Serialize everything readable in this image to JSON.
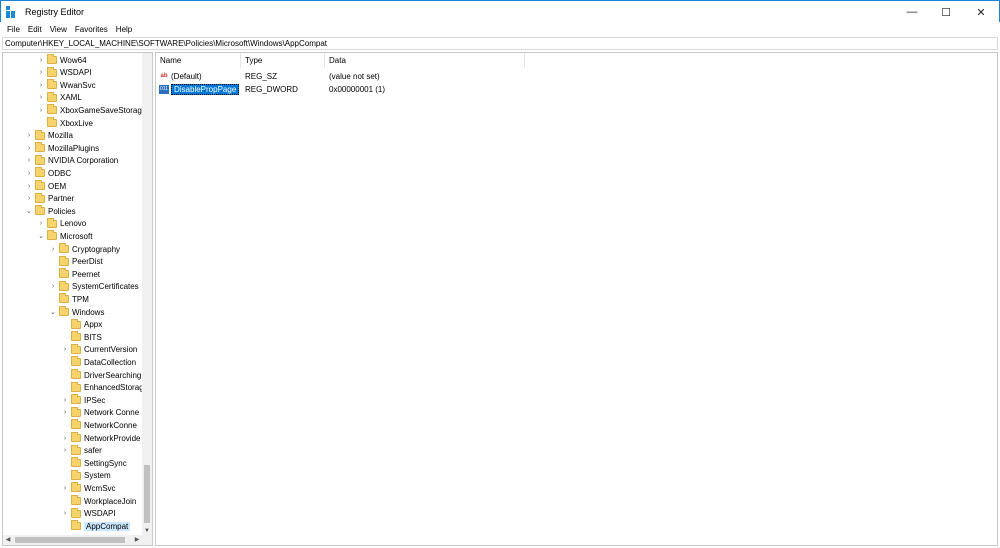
{
  "window": {
    "title": "Registry Editor",
    "minimize_glyph": "—",
    "maximize_glyph": "☐",
    "close_glyph": "✕"
  },
  "menu": [
    "File",
    "Edit",
    "View",
    "Favorites",
    "Help"
  ],
  "address": "Computer\\HKEY_LOCAL_MACHINE\\SOFTWARE\\Policies\\Microsoft\\Windows\\AppCompat",
  "tree": [
    {
      "label": "Wow64",
      "chevron": "›"
    },
    {
      "label": "WSDAPI",
      "chevron": "›"
    },
    {
      "label": "WwanSvc",
      "chevron": "›"
    },
    {
      "label": "XAML",
      "chevron": "›"
    },
    {
      "label": "XboxGameSaveStorag",
      "chevron": "›"
    },
    {
      "label": "XboxLive",
      "chevron": ""
    },
    {
      "label": "Mozilla",
      "chevron": "›"
    },
    {
      "label": "MozillaPlugins",
      "chevron": "›"
    },
    {
      "label": "NVIDIA Corporation",
      "chevron": "›"
    },
    {
      "label": "ODBC",
      "chevron": "›"
    },
    {
      "label": "OEM",
      "chevron": "›"
    },
    {
      "label": "Partner",
      "chevron": "›"
    },
    {
      "label": "Policies",
      "chevron": "⌄"
    },
    {
      "label": "Lenovo",
      "chevron": "›"
    },
    {
      "label": "Microsoft",
      "chevron": "⌄"
    },
    {
      "label": "Cryptography",
      "chevron": "›"
    },
    {
      "label": "PeerDist",
      "chevron": ""
    },
    {
      "label": "Peernet",
      "chevron": ""
    },
    {
      "label": "SystemCertificates",
      "chevron": "›"
    },
    {
      "label": "TPM",
      "chevron": ""
    },
    {
      "label": "Windows",
      "chevron": "⌄"
    },
    {
      "label": "Appx",
      "chevron": ""
    },
    {
      "label": "BITS",
      "chevron": ""
    },
    {
      "label": "CurrentVersion",
      "chevron": "›"
    },
    {
      "label": "DataCollection",
      "chevron": ""
    },
    {
      "label": "DriverSearching",
      "chevron": ""
    },
    {
      "label": "EnhancedStorag",
      "chevron": ""
    },
    {
      "label": "IPSec",
      "chevron": "›"
    },
    {
      "label": "Network Conne",
      "chevron": "›"
    },
    {
      "label": "NetworkConne",
      "chevron": ""
    },
    {
      "label": "NetworkProvide",
      "chevron": "›"
    },
    {
      "label": "safer",
      "chevron": "›"
    },
    {
      "label": "SettingSync",
      "chevron": ""
    },
    {
      "label": "System",
      "chevron": ""
    },
    {
      "label": "WcmSvc",
      "chevron": "›"
    },
    {
      "label": "WorkplaceJoin",
      "chevron": ""
    },
    {
      "label": "WSDAPI",
      "chevron": "›"
    },
    {
      "label": "AppCompat",
      "chevron": "",
      "selected": true
    }
  ],
  "columns": {
    "name": "Name",
    "type": "Type",
    "data": "Data"
  },
  "values": [
    {
      "icon": "ab",
      "name": "(Default)",
      "type": "REG_SZ",
      "data": "(value not set)"
    },
    {
      "icon": "011",
      "name": "DisablePropPage",
      "type": "REG_DWORD",
      "data": "0x00000001 (1)"
    }
  ]
}
